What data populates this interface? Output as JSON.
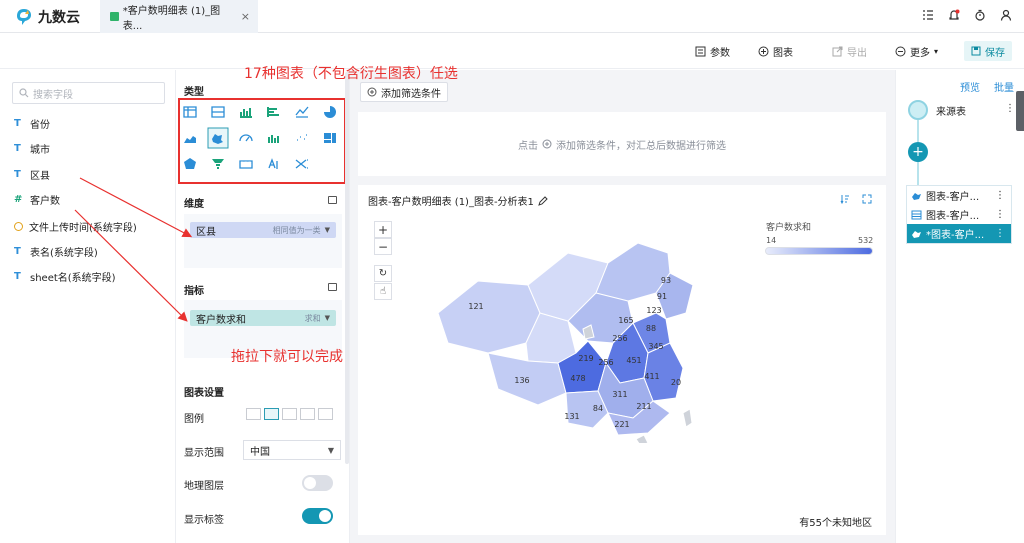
{
  "app": {
    "brand": "九数云"
  },
  "tab": {
    "title": "*客户数明细表 (1)_图表...",
    "close": "×"
  },
  "toolbar": {
    "params": "参数",
    "chart": "图表",
    "export": "导出",
    "more": "更多",
    "save": "保存"
  },
  "fields": {
    "search_placeholder": "搜索字段",
    "items": [
      {
        "type": "T",
        "label": "省份"
      },
      {
        "type": "T",
        "label": "城市"
      },
      {
        "type": "T",
        "label": "区县"
      },
      {
        "type": "#",
        "label": "客户数"
      },
      {
        "type": "clock",
        "label": "文件上传时间(系统字段)"
      },
      {
        "type": "T",
        "label": "表名(系统字段)"
      },
      {
        "type": "T",
        "label": "sheet名(系统字段)"
      }
    ]
  },
  "config": {
    "type_title": "类型",
    "dimension_title": "维度",
    "dimension_pill": {
      "label": "区县",
      "hint": "相同值为一类",
      "caret": "▼"
    },
    "indicator_title": "指标",
    "indicator_pill": {
      "label": "客户数求和",
      "hint": "求和",
      "caret": "▼"
    },
    "settings_title": "图表设置",
    "legend_label": "图例",
    "range_label": "显示范围",
    "range_value": "中国",
    "geo_layer_label": "地理图层",
    "geo_layer_on": false,
    "show_labels_label": "显示标签",
    "show_labels_on": true,
    "chart_types": [
      "table",
      "crosstab",
      "bar",
      "bar-h",
      "line",
      "pie",
      "area",
      "map",
      "gauge",
      "stacked",
      "scatter",
      "treemap",
      "radar",
      "funnel",
      "kpi",
      "wordcloud",
      "flow"
    ]
  },
  "main": {
    "add_filter": "添加筛选条件",
    "filter_hint_prefix": "点击",
    "filter_hint": "添加筛选条件，对汇总后数据进行筛选",
    "chart_title": "图表-客户数明细表 (1)_图表-分析表1",
    "legend_title": "客户数求和",
    "legend_min": "14",
    "legend_max": "532",
    "unknown_regions": "有55个未知地区",
    "zoom_in": "+",
    "zoom_out": "−",
    "reset": "↻",
    "pan": "☝"
  },
  "chart_data": {
    "type": "map",
    "region": "中国",
    "labels": [
      "121",
      "93",
      "91",
      "123",
      "165",
      "88",
      "256",
      "345",
      "219",
      "256",
      "451",
      "411",
      "20",
      "478",
      "136",
      "311",
      "84",
      "211",
      "131",
      "221"
    ],
    "legend_range": [
      14,
      532
    ]
  },
  "annotations": {
    "types": "17种图表（不包含衍生图表）任选",
    "drag": "拖拉下就可以完成"
  },
  "right_panel": {
    "preview": "预览",
    "batch": "批量",
    "source": "来源表",
    "add": "+",
    "charts": [
      "图表-客户...",
      "图表-客户...",
      "*图表-客户..."
    ]
  },
  "colors": {
    "accent": "#1497b3",
    "annotation": "#e8312f",
    "map_dark": "#4d6be0",
    "map_light": "#c7d0f5"
  }
}
